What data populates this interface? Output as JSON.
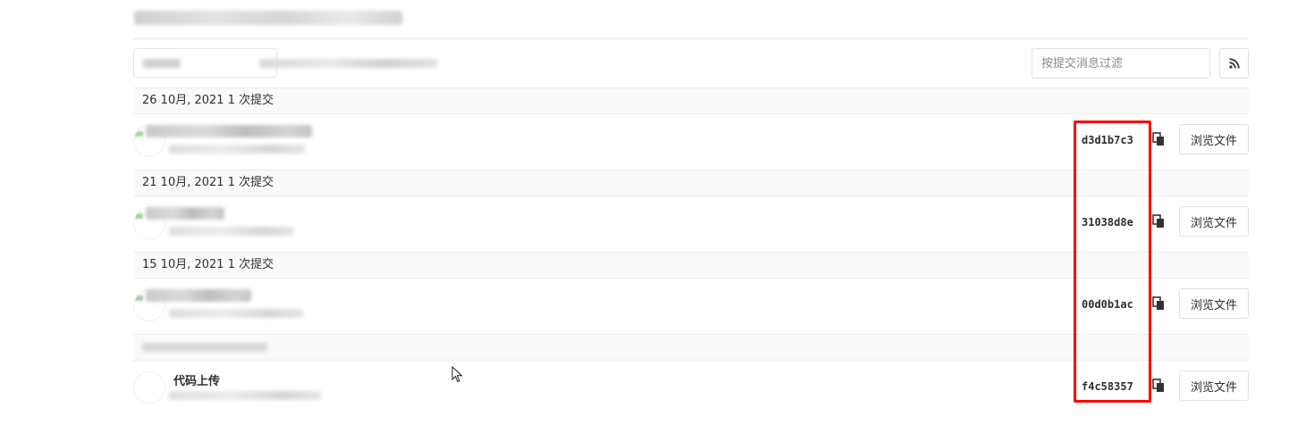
{
  "filter": {
    "placeholder": "按提交消息过滤"
  },
  "icons": {
    "rss": "rss-icon",
    "copy": "copy-icon",
    "cursor": "mouse-pointer-icon"
  },
  "accent_highlight": "#ff0000",
  "days": [
    {
      "header": "26 10月, 2021 1 次提交",
      "commit": {
        "title": "",
        "sha": "d3d1b7c3",
        "browse_label": "浏览文件"
      }
    },
    {
      "header": "21 10月, 2021 1 次提交",
      "commit": {
        "title": "",
        "sha": "31038d8e",
        "browse_label": "浏览文件"
      }
    },
    {
      "header": "15 10月, 2021 1 次提交",
      "commit": {
        "title": "",
        "sha": "00d0b1ac",
        "browse_label": "浏览文件"
      }
    },
    {
      "header": "",
      "commit": {
        "title": "代码上传",
        "sha": "f4c58357",
        "browse_label": "浏览文件"
      }
    }
  ]
}
